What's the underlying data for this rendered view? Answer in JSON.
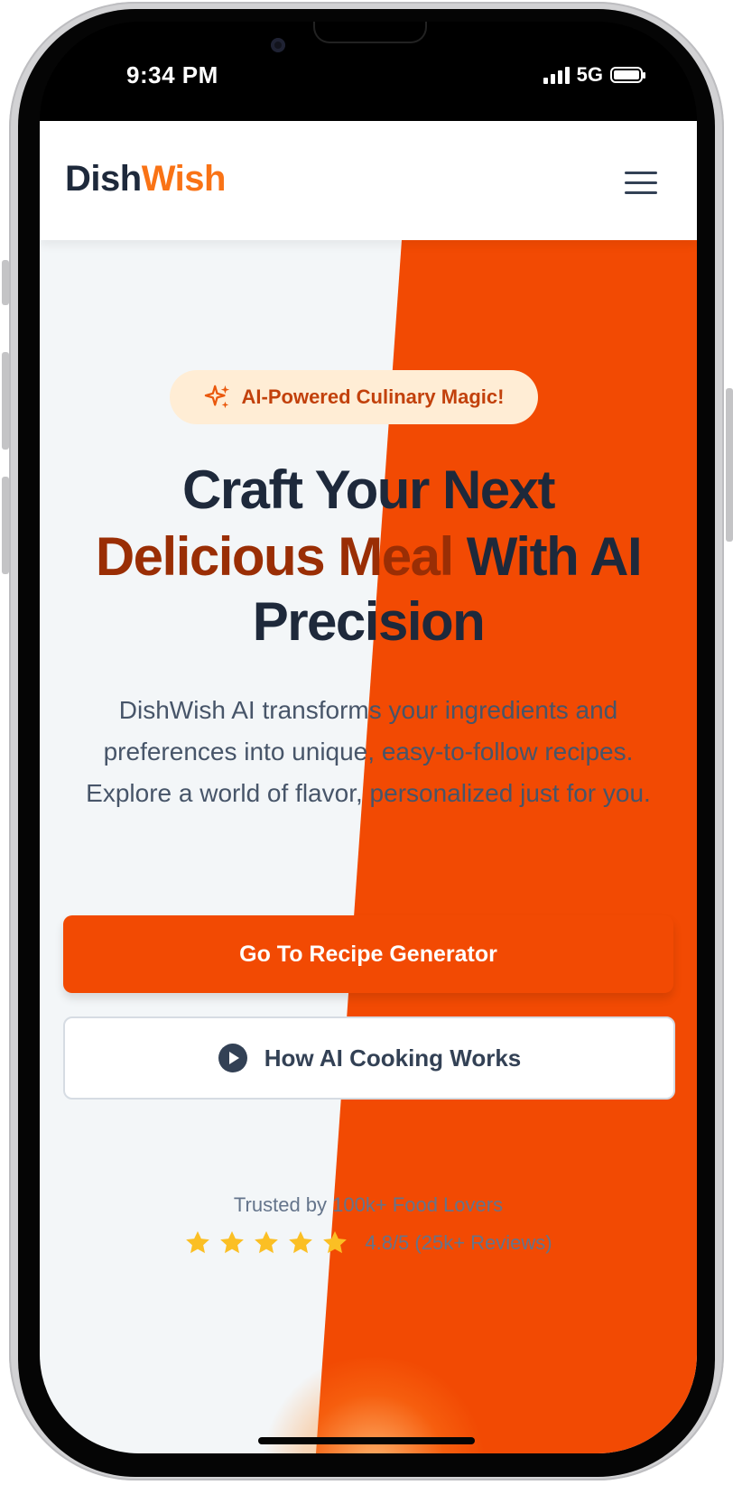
{
  "status_bar": {
    "time": "9:34 PM",
    "network": "5G"
  },
  "nav": {
    "logo_part1": "Dish",
    "logo_part2": "Wish"
  },
  "hero": {
    "badge_label": "AI-Powered Culinary Magic!",
    "headline_line1": "Craft Your Next",
    "headline_accent": "Delicious Meal",
    "headline_line2_rest": " With AI",
    "headline_line3": "Precision",
    "description": "DishWish AI transforms your ingredients and preferences into unique, easy-to-follow recipes. Explore a world of flavor, personalized just for you.",
    "primary_button": "Go To Recipe Generator",
    "secondary_button": "How AI Cooking Works",
    "trusted_text": "Trusted by 100k+ Food Lovers",
    "rating_text": "4.8/5 (25k+ Reviews)",
    "star_count": 5
  },
  "colors": {
    "brand_orange": "#f24a03",
    "logo_dark": "#1e293b",
    "logo_orange": "#f97316",
    "accent_text": "#9a2e05",
    "star": "#fbbf24"
  },
  "icons": {
    "badge": "sparkle-icon",
    "menu": "hamburger-menu-icon",
    "secondary_button": "play-icon",
    "rating": "star-icon"
  }
}
